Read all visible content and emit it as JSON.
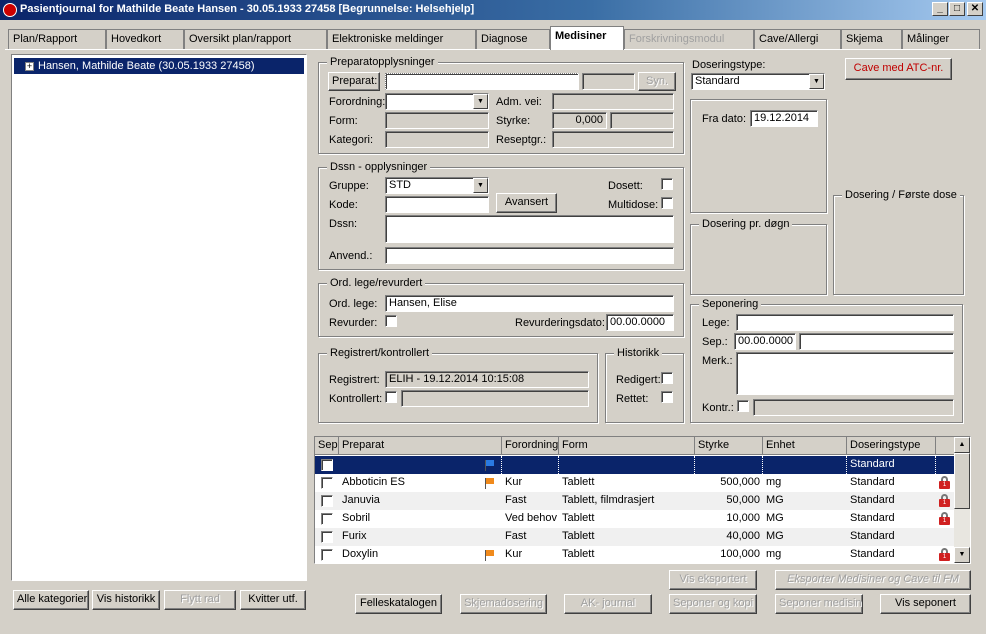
{
  "window": {
    "title": "Pasientjournal for Mathilde Beate Hansen - 30.05.1933 27458   [Begrunnelse: Helsehjelp]",
    "min_label": "_",
    "max_label": "□",
    "close_label": "✕"
  },
  "tabs": [
    {
      "label": "Plan/Rapport"
    },
    {
      "label": "Hovedkort"
    },
    {
      "label": "Oversikt plan/rapport"
    },
    {
      "label": "Elektroniske meldinger"
    },
    {
      "label": "Diagnose"
    },
    {
      "label": "Medisiner"
    },
    {
      "label": "Forskrivningsmodul"
    },
    {
      "label": "Cave/Allergi"
    },
    {
      "label": "Skjema"
    },
    {
      "label": "Målinger"
    }
  ],
  "tree": {
    "patient": "Hansen, Mathilde Beate (30.05.1933 27458)",
    "expander": "+"
  },
  "left_buttons": {
    "alle_kategorier": "Alle kategorier",
    "vis_historikk": "Vis historikk",
    "flytt_rad": "Flytt rad",
    "kvitter_utf": "Kvitter utf."
  },
  "preparat": {
    "group_label": "Preparatopplysninger",
    "preparat_button": "Preparat:",
    "preparat_value": "",
    "syn_button": "Syn.",
    "forordning_label": "Forordning:",
    "forordning_value": "",
    "adm_vei_label": "Adm. vei:",
    "form_label": "Form:",
    "styrke_label": "Styrke:",
    "styrke_value": "0,000",
    "kategori_label": "Kategori:",
    "reseptgr_label": "Reseptgr.:"
  },
  "dssn": {
    "group_label": "Dssn - opplysninger",
    "gruppe_label": "Gruppe:",
    "gruppe_value": "STD",
    "kode_label": "Kode:",
    "avansert_button": "Avansert",
    "dssn_label": "Dssn:",
    "anvend_label": "Anvend.:",
    "dosett_label": "Dosett:",
    "multidose_label": "Multidose:"
  },
  "ord_lege": {
    "group_label": "Ord. lege/revurdert",
    "ord_lege_label": "Ord. lege:",
    "ord_lege_value": "Hansen, Elise",
    "revurder_label": "Revurder:",
    "revurderingsdato_label": "Revurderingsdato:",
    "revurderingsdato_value": "00.00.0000"
  },
  "registrert": {
    "group_label": "Registrert/kontrollert",
    "registrert_label": "Registrert:",
    "registrert_value": "ELIH - 19.12.2014 10:15:08",
    "kontrollert_label": "Kontrollert:"
  },
  "historikk": {
    "group_label": "Historikk",
    "redigert_label": "Redigert:",
    "rettet_label": "Rettet:"
  },
  "dosering": {
    "type_label": "Doseringstype:",
    "type_value": "Standard",
    "fra_dato_label": "Fra dato:",
    "fra_dato_value": "19.12.2014",
    "pr_dogn_label": "Dosering pr. døgn",
    "forste_dose_label": "Dosering / Første dose",
    "cave_button": "Cave med ATC-nr."
  },
  "seponering": {
    "group_label": "Seponering",
    "lege_label": "Lege:",
    "sep_label": "Sep.:",
    "sep_value": "00.00.0000",
    "merk_label": "Merk.:",
    "kontr_label": "Kontr.:"
  },
  "grid": {
    "columns": [
      "Sep",
      "Preparat",
      "Forordning",
      "Form",
      "Styrke",
      "Enhet",
      "Doseringstype"
    ],
    "rows": [
      {
        "preparat": "",
        "forordning": "",
        "form": "",
        "styrke": "",
        "enhet": "",
        "doseringstype": "Standard",
        "flag": "blue-flag-icon",
        "locked": false
      },
      {
        "preparat": "Abboticin ES",
        "forordning": "Kur",
        "form": "Tablett",
        "styrke": "500,000",
        "enhet": "mg",
        "doseringstype": "Standard",
        "flag": "orange-flag-icon",
        "locked": true
      },
      {
        "preparat": "Januvia",
        "forordning": "Fast",
        "form": "Tablett, filmdrasjert",
        "styrke": "50,000",
        "enhet": "MG",
        "doseringstype": "Standard",
        "flag": "",
        "locked": true
      },
      {
        "preparat": "Sobril",
        "forordning": "Ved behov",
        "form": "Tablett",
        "styrke": "10,000",
        "enhet": "MG",
        "doseringstype": "Standard",
        "flag": "",
        "locked": true
      },
      {
        "preparat": "Furix",
        "forordning": "Fast",
        "form": "Tablett",
        "styrke": "40,000",
        "enhet": "MG",
        "doseringstype": "Standard",
        "flag": "",
        "locked": false
      },
      {
        "preparat": "Doxylin",
        "forordning": "Kur",
        "form": "Tablett",
        "styrke": "100,000",
        "enhet": "mg",
        "doseringstype": "Standard",
        "flag": "orange-flag-icon",
        "locked": true
      }
    ],
    "lock_badge": "1"
  },
  "bottom_buttons": {
    "vis_eksportert": "Vis eksportert",
    "eksporter": "Eksporter Medisiner og Cave til FM",
    "felleskatalogen": "Felleskatalogen",
    "skjemadosering": "Skjemadosering",
    "ak_journal": "AK- journal",
    "seponer_og_kopi": "Seponer og kopi",
    "seponer_medisin": "Seponer medisin",
    "vis_seponert": "Vis seponert"
  },
  "colors": {
    "title_start": "#0a246a",
    "selection": "#0a246a",
    "cave_button_text": "#c00000",
    "blue_flag": "#2a7ae2",
    "orange_flag": "#f08a1c",
    "lock": "#d02020"
  }
}
